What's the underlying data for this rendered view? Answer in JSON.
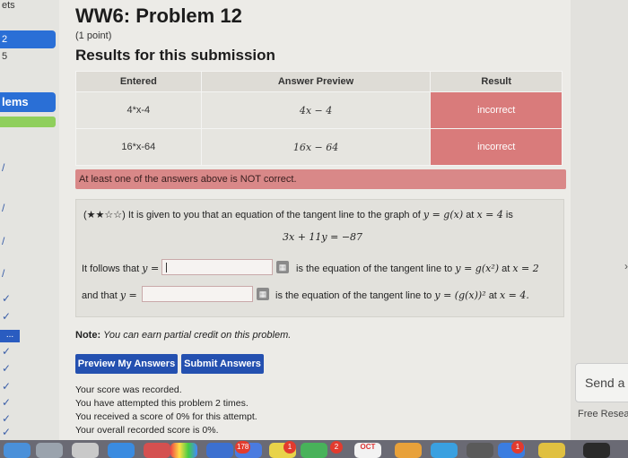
{
  "sidebar": {
    "top_text": "ets",
    "highlight_label": "2",
    "item_5": "5",
    "active_label": "lems",
    "dots_label": "..."
  },
  "problem": {
    "title": "WW6: Problem 12",
    "points": "(1 point)",
    "results_heading": "Results for this submission",
    "table": {
      "headers": [
        "Entered",
        "Answer Preview",
        "Result"
      ],
      "rows": [
        {
          "entered": "4*x-4",
          "preview": "4x − 4",
          "result": "incorrect"
        },
        {
          "entered": "16*x-64",
          "preview": "16x − 64",
          "result": "incorrect"
        }
      ]
    },
    "alert": "At least one of the answers above is NOT correct.",
    "statement_prefix": "(★★☆☆) It is given to you that an equation of the tangent line to the graph of",
    "statement_func": "y = g(x)",
    "statement_at": "at",
    "statement_point": "x = 4",
    "statement_is": "is",
    "equation": "3x + 11y = −87",
    "q1_label_prefix": "It follows that",
    "q1_var": "y =",
    "q1_after": "is the equation of the tangent line to",
    "q1_func": "y = g(x²)",
    "q1_at": "at",
    "q1_point": "x = 2",
    "q2_label_prefix": "and that",
    "q2_var": "y =",
    "q2_after": "is the equation of the tangent line to",
    "q2_func": "y = (g(x))²",
    "q2_at": "at",
    "q2_point": "x = 4.",
    "answer1_value": "",
    "answer2_value": "",
    "note_label": "Note:",
    "note_text": "You can earn partial credit on this problem.",
    "preview_button": "Preview My Answers",
    "submit_button": "Submit Answers",
    "score_lines": [
      "Your score was recorded.",
      "You have attempted this problem 2 times.",
      "You received a score of 0% for this attempt.",
      "Your overall recorded score is 0%."
    ]
  },
  "right_panel": {
    "send_label": "Send a",
    "free_label": "Free Resear"
  },
  "dock": {
    "badge_178": "178",
    "badge_1a": "1",
    "badge_2": "2",
    "calendar_label": "OCT",
    "badge_1b": "1"
  },
  "colors": {
    "incorrect_bg": "#d97b7b",
    "alert_bg": "#d98888",
    "button_bg": "#2450b0",
    "sidebar_highlight": "#2a6fd6"
  }
}
